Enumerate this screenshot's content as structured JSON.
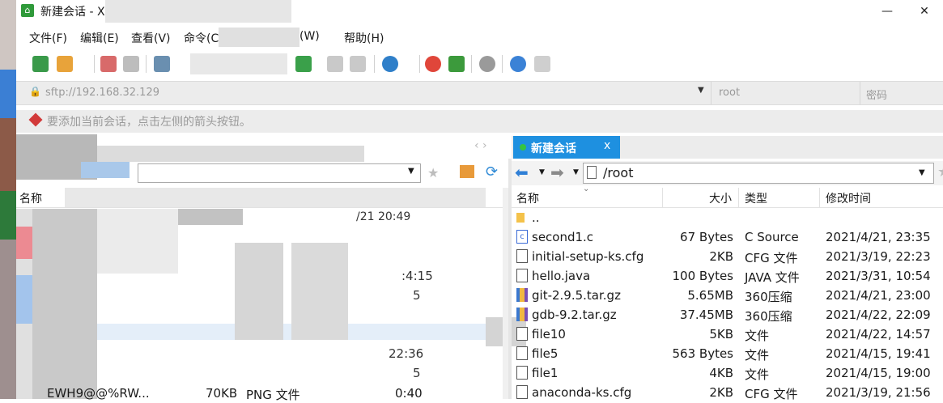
{
  "window": {
    "title": "新建会话 - X",
    "min_label": "—",
    "close_label": "✕"
  },
  "menu": [
    "文件(F)",
    "编辑(E)",
    "查看(V)",
    "命令(C)",
    "(W)",
    "帮助(H)"
  ],
  "address": {
    "url_placeholder": "sftp://192.168.32.129",
    "user_placeholder": "root",
    "password_placeholder": "密码"
  },
  "hint": "要添加当前会话，点击左侧的箭头按钮。",
  "left_pane": {
    "header_name": "名称",
    "row_fragments": [
      "/21 20:49",
      ":4:15",
      "5",
      "22:36",
      "5",
      "0:40"
    ],
    "last_row": {
      "name": "EWH9@@%RW...",
      "size": "70KB",
      "type": "PNG 文件"
    },
    "nav_arrows": "‹ ›"
  },
  "right_pane": {
    "tab_label": "新建会话",
    "tab_close": "x",
    "path": "/root",
    "columns": {
      "name": "名称",
      "size": "大小",
      "type": "类型",
      "modified": "修改时间"
    },
    "files": [
      {
        "icon": "folder",
        "name": "..",
        "size": "",
        "type": "",
        "modified": ""
      },
      {
        "icon": "c",
        "name": "second1.c",
        "size": "67 Bytes",
        "type": "C Source",
        "modified": "2021/4/21, 23:35"
      },
      {
        "icon": "file",
        "name": "initial-setup-ks.cfg",
        "size": "2KB",
        "type": "CFG 文件",
        "modified": "2021/3/19, 22:23"
      },
      {
        "icon": "file",
        "name": "hello.java",
        "size": "100 Bytes",
        "type": "JAVA 文件",
        "modified": "2021/3/31, 10:54"
      },
      {
        "icon": "zip",
        "name": "git-2.9.5.tar.gz",
        "size": "5.65MB",
        "type": "360压缩",
        "modified": "2021/4/21, 23:00"
      },
      {
        "icon": "zip",
        "name": "gdb-9.2.tar.gz",
        "size": "37.45MB",
        "type": "360压缩",
        "modified": "2021/4/22, 22:09"
      },
      {
        "icon": "file",
        "name": "file10",
        "size": "5KB",
        "type": "文件",
        "modified": "2021/4/22, 14:57"
      },
      {
        "icon": "file",
        "name": "file5",
        "size": "563 Bytes",
        "type": "文件",
        "modified": "2021/4/15, 19:41"
      },
      {
        "icon": "file",
        "name": "file1",
        "size": "4KB",
        "type": "文件",
        "modified": "2021/4/15, 19:00"
      },
      {
        "icon": "file",
        "name": "anaconda-ks.cfg",
        "size": "2KB",
        "type": "CFG 文件",
        "modified": "2021/3/19, 21:56"
      }
    ]
  },
  "colors": {
    "tab_active": "#1e90e0",
    "connected_dot": "#35c441"
  }
}
